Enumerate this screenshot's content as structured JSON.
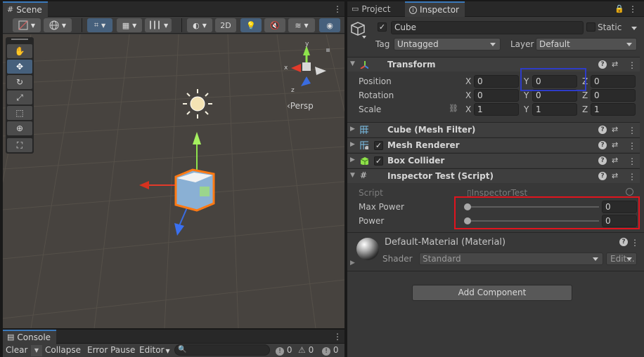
{
  "scene": {
    "tab_label": "Scene",
    "toolbar": {
      "btn_2d": "2D"
    },
    "persp_label": "‹Persp"
  },
  "console": {
    "tab_label": "Console",
    "clear_label": "Clear",
    "collapse_label": "Collapse",
    "error_pause_label": "Error Pause",
    "editor_label": "Editor",
    "search_placeholder": "",
    "log_count": "0",
    "warn_count": "0",
    "error_count": "0"
  },
  "panel": {
    "project_tab": "Project",
    "inspector_tab": "Inspector"
  },
  "object": {
    "name": "Cube",
    "static_label": "Static",
    "tag_label": "Tag",
    "tag_value": "Untagged",
    "layer_label": "Layer",
    "layer_value": "Default"
  },
  "transform": {
    "title": "Transform",
    "rows": [
      {
        "label": "Position",
        "x": "0",
        "y": "0",
        "z": "0"
      },
      {
        "label": "Rotation",
        "x": "0",
        "y": "0",
        "z": "0"
      },
      {
        "label": "Scale",
        "x": "1",
        "y": "1",
        "z": "1"
      }
    ],
    "axis_x": "X",
    "axis_y": "Y",
    "axis_z": "Z"
  },
  "components": {
    "mesh_filter": "Cube (Mesh Filter)",
    "mesh_renderer": "Mesh Renderer",
    "box_collider": "Box Collider",
    "inspector_test": "Inspector Test (Script)"
  },
  "script_fields": {
    "script_label": "Script",
    "script_value": "InspectorTest",
    "max_power_label": "Max Power",
    "max_power_value": "0",
    "power_label": "Power",
    "power_value": "0"
  },
  "material": {
    "title": "Default-Material (Material)",
    "shader_label": "Shader",
    "shader_value": "Standard",
    "edit_label": "Edit..."
  },
  "add_component_label": "Add Component",
  "colors": {
    "accent": "#3a79bb",
    "highlight_red": "#e0141e",
    "highlight_blue": "#2e3cc8",
    "scene_bg": "#47433f",
    "panel_bg": "#383838"
  }
}
